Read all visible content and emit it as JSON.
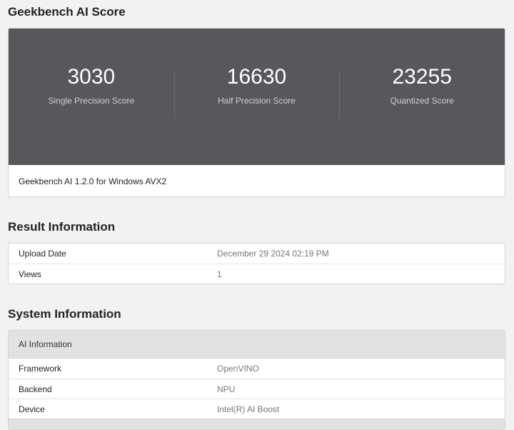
{
  "score_section": {
    "title": "Geekbench AI Score",
    "scores": [
      {
        "value": "3030",
        "label": "Single Precision Score"
      },
      {
        "value": "16630",
        "label": "Half Precision Score"
      },
      {
        "value": "23255",
        "label": "Quantized Score"
      }
    ],
    "footer": "Geekbench AI 1.2.0 for Windows AVX2"
  },
  "result_section": {
    "title": "Result Information",
    "rows": [
      {
        "key": "Upload Date",
        "value": "December 29 2024 02:19 PM"
      },
      {
        "key": "Views",
        "value": "1"
      }
    ]
  },
  "system_section": {
    "title": "System Information",
    "group_title": "AI Information",
    "rows": [
      {
        "key": "Framework",
        "value": "OpenVINO"
      },
      {
        "key": "Backend",
        "value": "NPU"
      },
      {
        "key": "Device",
        "value": "Intel(R) AI Boost"
      }
    ]
  },
  "colors": {
    "banner_bg": "#58585c",
    "page_bg": "#f2f2f2",
    "group_header_bg": "#e2e2e2"
  }
}
